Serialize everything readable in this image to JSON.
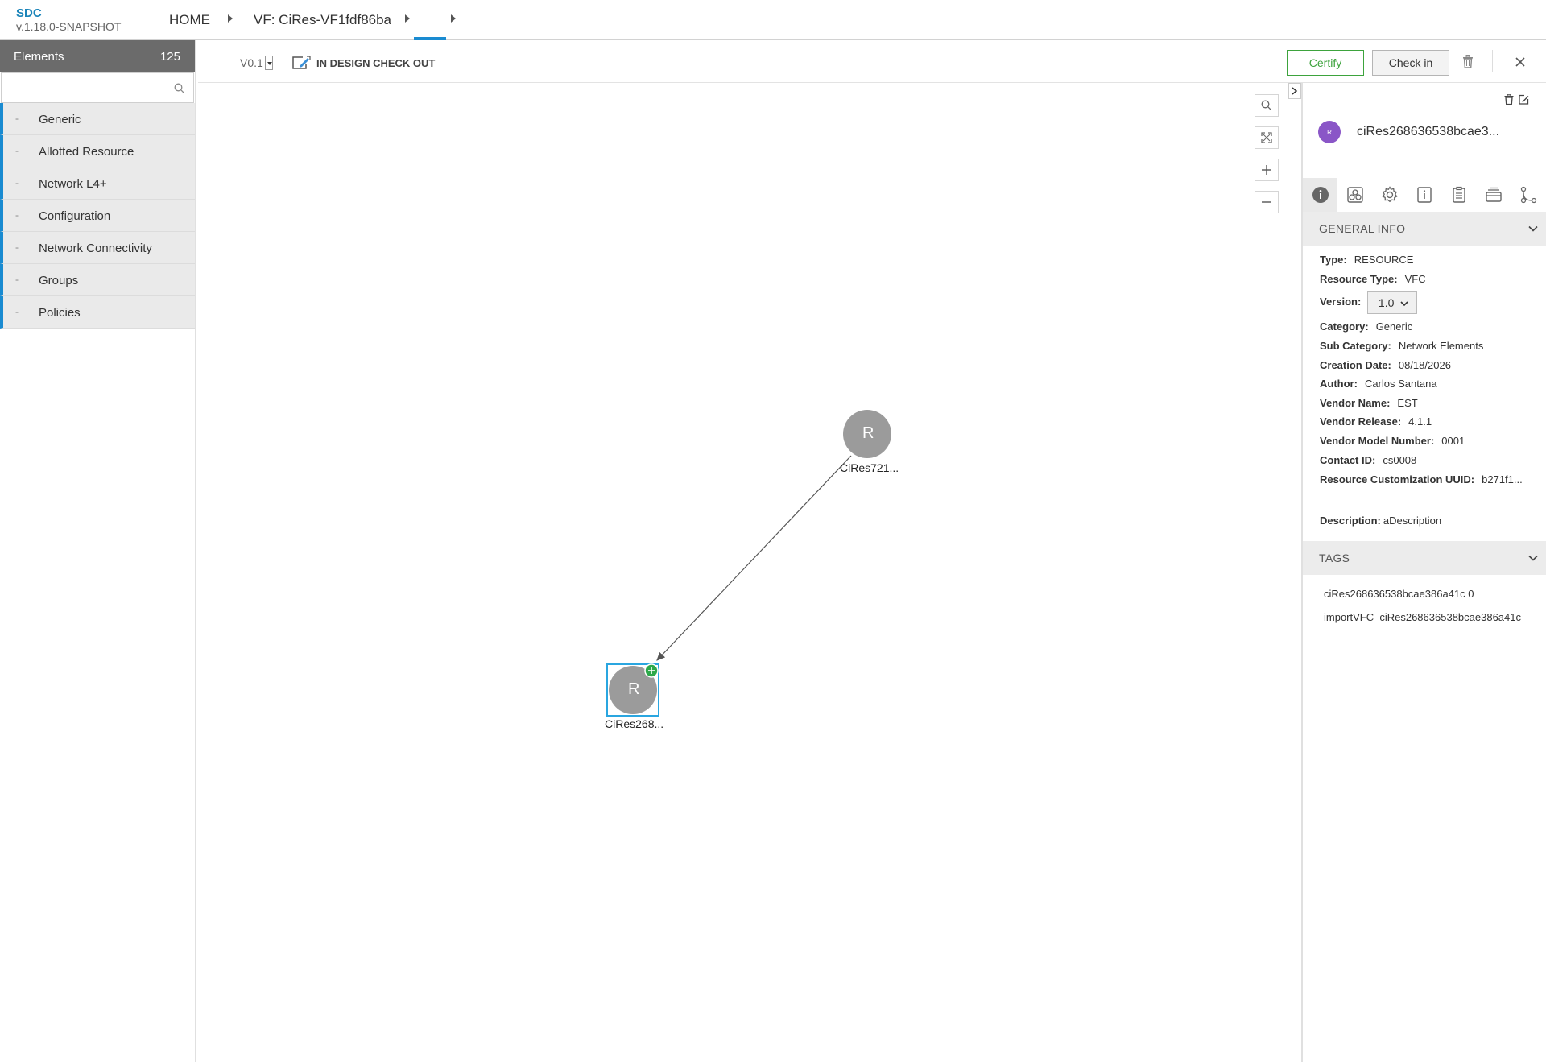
{
  "header": {
    "app_name": "SDC",
    "version": "v.1.18.0-SNAPSHOT",
    "crumb_home": "HOME",
    "crumb_vf": "VF: CiRes-VF1fdf86ba"
  },
  "palette": {
    "title": "Elements",
    "count": "125",
    "search_placeholder": "",
    "items": [
      {
        "label": "Generic"
      },
      {
        "label": "Allotted Resource"
      },
      {
        "label": "Network L4+"
      },
      {
        "label": "Configuration"
      },
      {
        "label": "Network Connectivity"
      },
      {
        "label": "Groups"
      },
      {
        "label": "Policies"
      }
    ]
  },
  "toolbar": {
    "version": "V0.1",
    "status": "IN DESIGN CHECK OUT",
    "certify_label": "Certify",
    "checkin_label": "Check in"
  },
  "canvas": {
    "nodes": [
      {
        "letter": "R",
        "label": "CiRes721..."
      },
      {
        "letter": "R",
        "label": "CiRes268..."
      }
    ]
  },
  "right_panel": {
    "avatar_letter": "R",
    "component_name": "ciRes268636538bcae3...",
    "general_info_title": "GENERAL INFO",
    "info": {
      "type_k": "Type:",
      "type_v": "RESOURCE",
      "resource_type_k": "Resource Type:",
      "resource_type_v": "VFC",
      "version_k": "Version:",
      "version_v": "1.0",
      "category_k": "Category:",
      "category_v": "Generic",
      "sub_category_k": "Sub Category:",
      "sub_category_v": "Network Elements",
      "creation_date_k": "Creation Date:",
      "creation_date_v": "08/18/2026",
      "author_k": "Author:",
      "author_v": "Carlos Santana",
      "vendor_name_k": "Vendor Name:",
      "vendor_name_v": "EST",
      "vendor_release_k": "Vendor Release:",
      "vendor_release_v": "4.1.1",
      "vendor_model_k": "Vendor Model Number:",
      "vendor_model_v": "0001",
      "contact_id_k": "Contact ID:",
      "contact_id_v": "cs0008",
      "uuid_k": "Resource Customization UUID:",
      "uuid_v": "b271f1...",
      "description_k": "Description:",
      "description_v": "aDescription"
    },
    "tags_title": "TAGS",
    "tags": [
      "ciRes268636538bcae386a41c 0",
      "importVFC  ciRes268636538bcae386a41c"
    ]
  },
  "colors": {
    "accent": "#1a8bd1",
    "certify": "#3da33d",
    "avatar": "#8a56c7",
    "node": "#9b9b9b"
  }
}
